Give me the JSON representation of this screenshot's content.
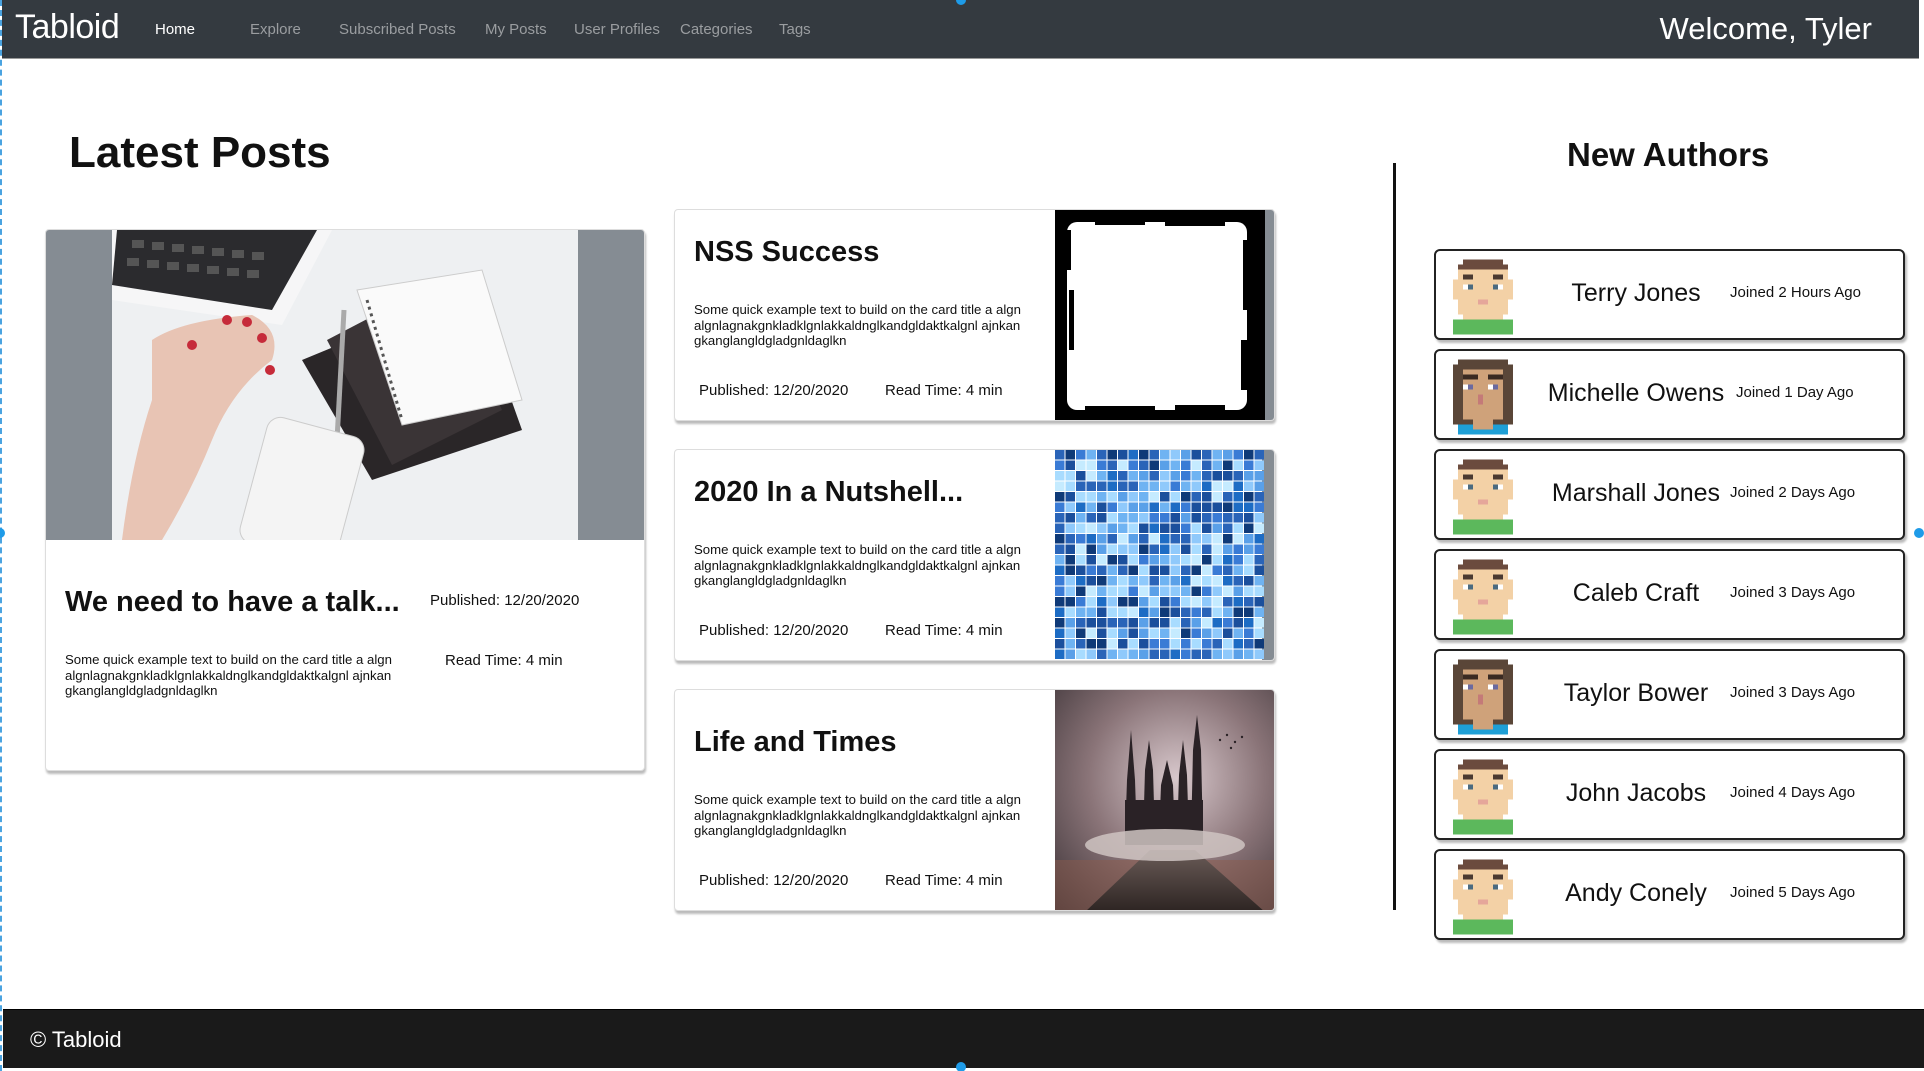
{
  "navbar": {
    "brand": "Tabloid",
    "links": [
      {
        "label": "Home",
        "active": true
      },
      {
        "label": "Explore",
        "active": false
      },
      {
        "label": "Subscribed Posts",
        "active": false
      },
      {
        "label": "My Posts",
        "active": false
      },
      {
        "label": "User Profiles",
        "active": false
      },
      {
        "label": "Categories",
        "active": false
      },
      {
        "label": "Tags",
        "active": false
      }
    ],
    "welcome": "Welcome, Tyler"
  },
  "latest": {
    "heading": "Latest Posts",
    "featured": {
      "title": "We need to have a talk...",
      "body": "Some quick example text to build on the card title a algnalgnlagnakgnkladklgnlakkaldnglkandgldaktkalgnl ajnkangkanglangldgladgnldaglkn",
      "published": "Published: 12/20/2020",
      "read_time": "Read Time: 4 min",
      "image": "laptop-desk-photo"
    },
    "posts": [
      {
        "title": "NSS Success",
        "body": "Some quick example text to build on the card title a algnalgnlagnakgnkladklgnlakkaldnglkandgldaktkalgnl ajnkangkanglangldgladgnldaglkn",
        "published": "Published: 12/20/2020",
        "read_time": "Read Time: 4 min",
        "image": "grunge-frame"
      },
      {
        "title": "2020 In a Nutshell...",
        "body": "Some quick example text to build on the card title a algnalgnlagnakgnkladklgnlakkaldnglkandgldaktkalgnl ajnkangkanglangldgladgnldaglkn",
        "published": "Published: 12/20/2020",
        "read_time": "Read Time: 4 min",
        "image": "blue-mosaic"
      },
      {
        "title": "Life and Times",
        "body": "Some quick example text to build on the card title a algnalgnlagnakgnkladklgnlakkaldnglkandgldaktkalgnl ajnkangkanglangldgladgnldaglkn",
        "published": "Published: 12/20/2020",
        "read_time": "Read Time: 4 min",
        "image": "dark-castle"
      }
    ]
  },
  "authors": {
    "heading": "New Authors",
    "items": [
      {
        "name": "Terry Jones",
        "joined": "Joined 2 Hours Ago",
        "avatar": "male"
      },
      {
        "name": "Michelle Owens",
        "joined": "Joined 1 Day Ago",
        "avatar": "female"
      },
      {
        "name": "Marshall Jones",
        "joined": "Joined 2 Days Ago",
        "avatar": "male"
      },
      {
        "name": "Caleb Craft",
        "joined": "Joined 3 Days Ago",
        "avatar": "male"
      },
      {
        "name": "Taylor Bower",
        "joined": "Joined 3 Days Ago",
        "avatar": "female"
      },
      {
        "name": "John Jacobs",
        "joined": "Joined 4 Days Ago",
        "avatar": "male"
      },
      {
        "name": "Andy Conely",
        "joined": "Joined 5 Days Ago",
        "avatar": "male"
      }
    ]
  },
  "footer": {
    "text": "© Tabloid"
  },
  "colors": {
    "navbar_bg": "#343a40",
    "footer_bg": "#1a1a1a",
    "nav_inactive": "#9a9da0",
    "nav_active": "#ffffff",
    "image_gutter": "#858c93"
  }
}
